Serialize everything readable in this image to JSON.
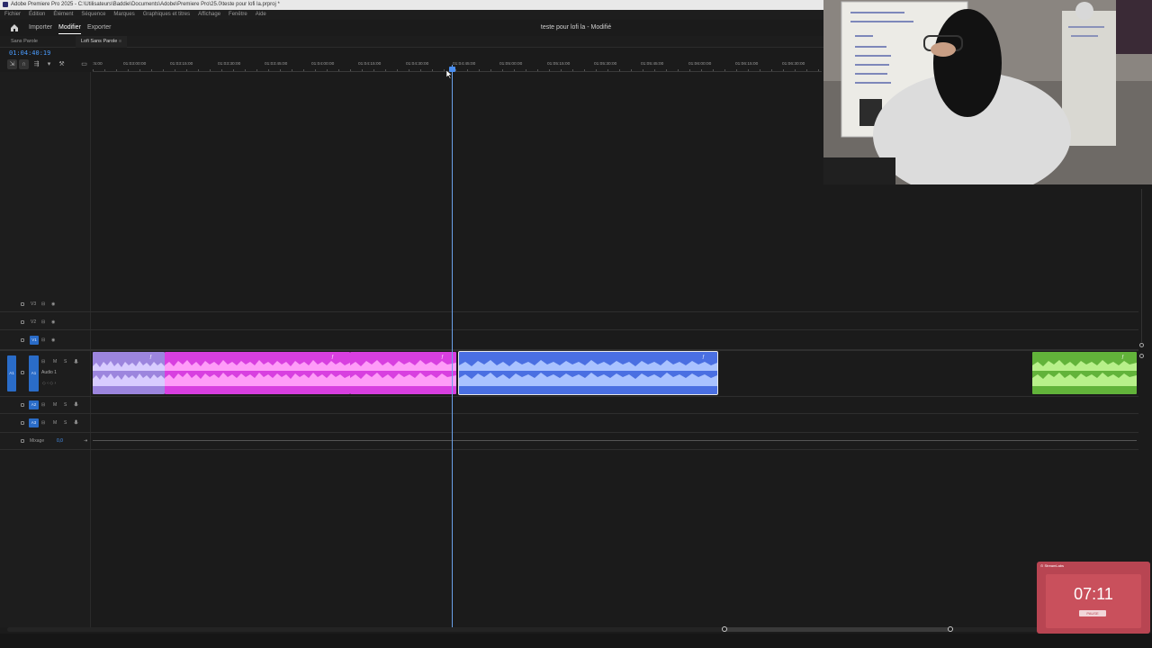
{
  "window": {
    "title": "Adobe Premiere Pro 2025 - C:\\Utilisateurs\\Baddie\\Documents\\Adobe\\Premiere Pro\\25.0\\teste pour lofi la.prproj *"
  },
  "menu": [
    "Fichier",
    "Édition",
    "Élément",
    "Séquence",
    "Marques",
    "Graphiques et titres",
    "Affichage",
    "Fenêtre",
    "Aide"
  ],
  "workspace": {
    "tabs": [
      {
        "label": "Importer"
      },
      {
        "label": "Modifier"
      },
      {
        "label": "Exporter"
      }
    ],
    "active_tab": "Modifier",
    "doc_title": "teste pour lofi la - Modifié"
  },
  "sequences": [
    {
      "label": "Sans Parole"
    },
    {
      "label": "Lofi Sans Parole"
    }
  ],
  "timeline": {
    "timecode": "01:04:40:19",
    "ruler_labels": [
      ":5:00",
      "01:03:00:00",
      "01:03:15:00",
      "01:03:30:00",
      "01:03:45:00",
      "01:04:00:00",
      "01:04:15:00",
      "01:04:30:00",
      "01:04:45:00",
      "01:05:00:00",
      "01:05:15:00",
      "01:05:30:00",
      "01:05:45:00",
      "01:06:00:00",
      "01:06:15:00",
      "01:06:30:00"
    ],
    "video_tracks": [
      {
        "name": "V3"
      },
      {
        "name": "V2"
      },
      {
        "name": "V1"
      }
    ],
    "audio_tracks": [
      {
        "name": "A1",
        "label": "Audio 1",
        "m": "M",
        "s": "S"
      },
      {
        "name": "A2",
        "m": "M",
        "s": "S"
      },
      {
        "name": "A3",
        "m": "M",
        "s": "S"
      }
    ],
    "mix": {
      "label": "Mixage",
      "value": "0,0"
    },
    "clip_colors": {
      "lavender": "#a48ee8",
      "magenta": "#e04ce6",
      "blue": "#4d73e6",
      "green": "#6cc03c"
    }
  },
  "timer_widget": {
    "time": "07:11",
    "header": "⊙ StreamLabs",
    "button": "PAUSE"
  },
  "icons": [
    "home-icon",
    "lock-icon",
    "eye-icon",
    "mic-icon",
    "wrench-icon",
    "magnet-icon",
    "marker-icon",
    "fx-icon"
  ]
}
